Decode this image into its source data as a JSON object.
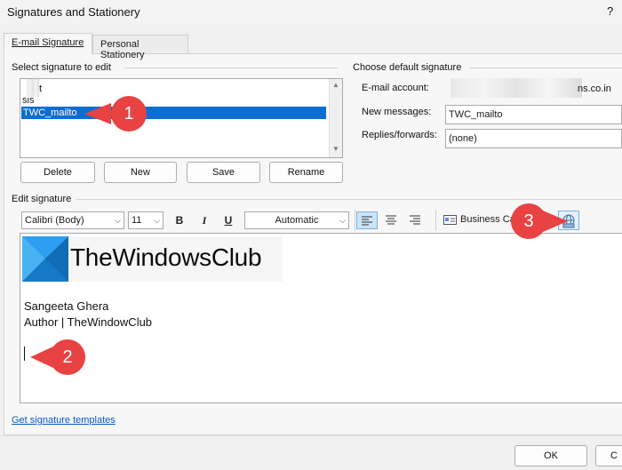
{
  "window": {
    "title": "Signatures and Stationery",
    "help": "?"
  },
  "tabs": [
    {
      "label": "E-mail Signature",
      "active": true
    },
    {
      "label": "Personal Stationery",
      "active": false
    }
  ],
  "left": {
    "section_label": "Select signature to edit",
    "items": [
      "t",
      "sis",
      "TWC_mailto"
    ],
    "selected": "TWC_mailto",
    "buttons": {
      "delete": "Delete",
      "new": "New",
      "save": "Save",
      "rename": "Rename"
    }
  },
  "right": {
    "section_label": "Choose default signature",
    "email_label": "E-mail account:",
    "email_value_fragment": "ns.co.in",
    "new_messages_label": "New messages:",
    "new_messages_value": "TWC_mailto",
    "replies_label": "Replies/forwards:",
    "replies_value": "(none)"
  },
  "editor": {
    "section_label": "Edit signature",
    "font": "Calibri (Body)",
    "size": "11",
    "bold": "B",
    "italic": "I",
    "underline": "U",
    "color": "Automatic",
    "business_card_label": "Business Ca",
    "logo_text": "TheWindowsClub",
    "line1": "Sangeeta Ghera",
    "line2": "Author | TheWindowClub",
    "logo_colors": {
      "accent": "#1e8fe0",
      "accent_light": "#49b3f2",
      "accent_dark": "#0f6cb5"
    }
  },
  "templates_link": "Get signature templates",
  "footer": {
    "ok": "OK",
    "cancel": "C"
  },
  "annotations": [
    "1",
    "2",
    "3"
  ],
  "colors": {
    "selection": "#0b6ed3",
    "badge": "#e84242",
    "link": "#0a58ca"
  }
}
